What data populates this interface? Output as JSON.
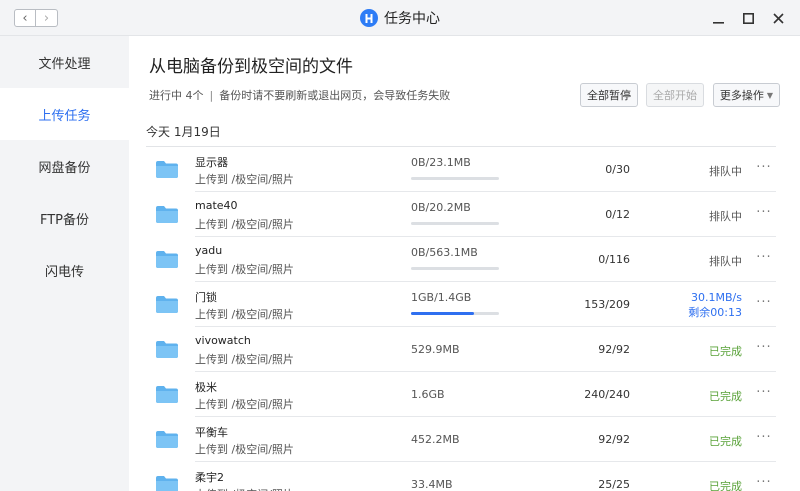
{
  "titlebar": {
    "title": "任务中心",
    "back_icon": "chevron-left-icon",
    "forward_icon": "chevron-right-icon",
    "back_glyph": "‹",
    "forward_glyph": "›"
  },
  "sidebar": {
    "items": [
      {
        "label": "文件处理",
        "active": false
      },
      {
        "label": "上传任务",
        "active": true
      },
      {
        "label": "网盘备份",
        "active": false
      },
      {
        "label": "FTP备份",
        "active": false
      },
      {
        "label": "闪电传",
        "active": false
      }
    ]
  },
  "main": {
    "title": "从电脑备份到极空间的文件",
    "status_count": "进行中 4个",
    "status_separator": "|",
    "status_note": "备份时请不要刷新或退出网页，会导致任务失败",
    "buttons": {
      "pause_all": "全部暂停",
      "start_all": "全部开始",
      "more": "更多操作"
    },
    "date_label": "今天 1月19日",
    "more_glyph": "···"
  },
  "colors": {
    "accent": "#2d6ff0",
    "done": "#5aa33a",
    "folder": "#5fb2ee"
  },
  "tasks": [
    {
      "name": "显示器",
      "dest": "上传到 /极空间/照片",
      "size": "0B/23.1MB",
      "progress": 0,
      "count": "0/30",
      "status": "排队中",
      "status_type": "queued"
    },
    {
      "name": "mate40",
      "dest": "上传到 /极空间/照片",
      "size": "0B/20.2MB",
      "progress": 0,
      "count": "0/12",
      "status": "排队中",
      "status_type": "queued"
    },
    {
      "name": "yadu",
      "dest": "上传到 /极空间/照片",
      "size": "0B/563.1MB",
      "progress": 0,
      "count": "0/116",
      "status": "排队中",
      "status_type": "queued"
    },
    {
      "name": "门锁",
      "dest": "上传到 /极空间/照片",
      "size": "1GB/1.4GB",
      "progress": 0.72,
      "count": "153/209",
      "status": "30.1MB/s",
      "status2": "剩余00:13",
      "status_type": "active"
    },
    {
      "name": "vivowatch",
      "dest": "上传到 /极空间/照片",
      "size": "529.9MB",
      "count": "92/92",
      "status": "已完成",
      "status_type": "done"
    },
    {
      "name": "极米",
      "dest": "上传到 /极空间/照片",
      "size": "1.6GB",
      "count": "240/240",
      "status": "已完成",
      "status_type": "done"
    },
    {
      "name": "平衡车",
      "dest": "上传到 /极空间/照片",
      "size": "452.2MB",
      "count": "92/92",
      "status": "已完成",
      "status_type": "done"
    },
    {
      "name": "柔宇2",
      "dest": "上传到 /极空间/照片",
      "size": "33.4MB",
      "count": "25/25",
      "status": "已完成",
      "status_type": "done"
    }
  ]
}
